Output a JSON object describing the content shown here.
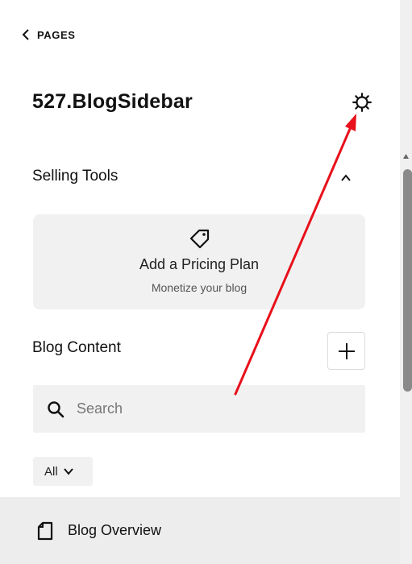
{
  "nav": {
    "back_label": "PAGES",
    "back_icon": "chevron-left-icon"
  },
  "header": {
    "page_title": "527.BlogSidebar",
    "settings_icon": "gear-icon"
  },
  "selling_tools": {
    "title": "Selling Tools",
    "toggle_icon": "chevron-up-icon",
    "pricing_card": {
      "icon": "tag-icon",
      "label": "Add a Pricing Plan",
      "subtitle": "Monetize your blog"
    }
  },
  "blog_content": {
    "title": "Blog Content",
    "add_icon": "plus-icon",
    "search": {
      "placeholder": "Search",
      "value": "",
      "icon": "search-icon"
    },
    "filter": {
      "selected": "All",
      "icon": "chevron-down-icon"
    },
    "items": [
      {
        "label": "Blog Overview",
        "icon": "page-icon"
      }
    ]
  },
  "annotation": {
    "type": "arrow",
    "color": "#e8101b",
    "points_to": "settings gear"
  },
  "colors": {
    "card_bg": "#f1f1f1",
    "row_bg": "#ededed",
    "text": "#111111",
    "scroll_thumb": "#8a8a8a"
  }
}
